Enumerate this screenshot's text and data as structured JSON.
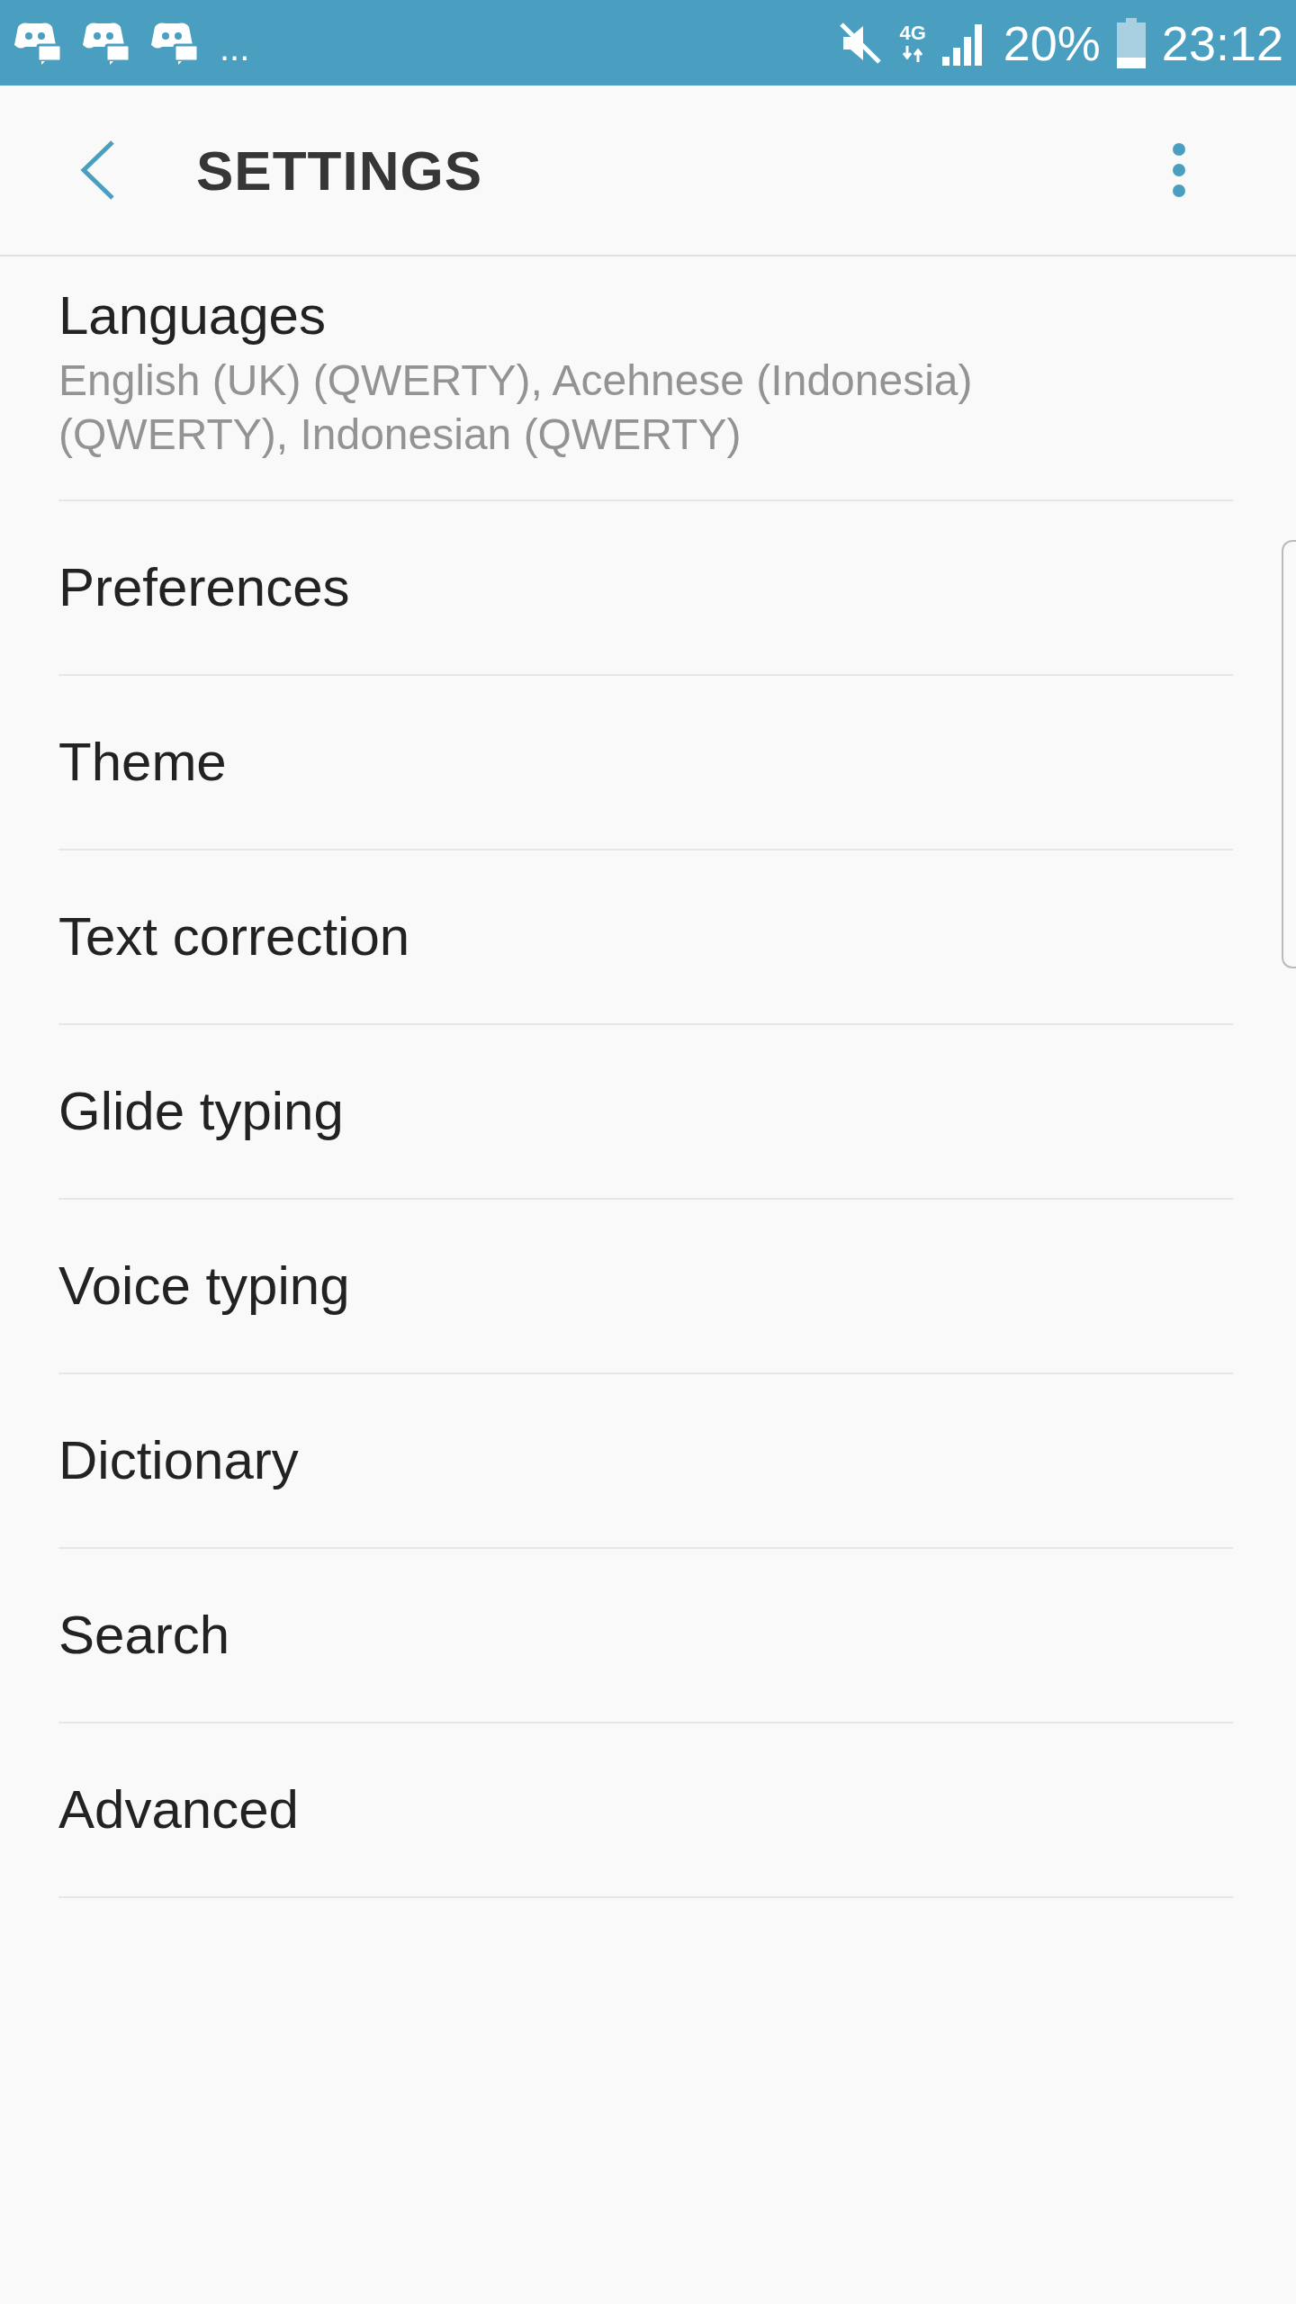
{
  "status_bar": {
    "notifications": [
      {
        "kind": "chat"
      },
      {
        "kind": "chat"
      },
      {
        "kind": "chat"
      }
    ],
    "more": "...",
    "network": "4G",
    "battery": "20%",
    "time": "23:12"
  },
  "header": {
    "title": "SETTINGS"
  },
  "items": [
    {
      "title": "Languages",
      "subtitle": "English (UK) (QWERTY), Acehnese (Indonesia) (QWERTY), Indonesian (QWERTY)"
    },
    {
      "title": "Preferences"
    },
    {
      "title": "Theme"
    },
    {
      "title": "Text correction"
    },
    {
      "title": "Glide typing"
    },
    {
      "title": "Voice typing"
    },
    {
      "title": "Dictionary"
    },
    {
      "title": "Search"
    },
    {
      "title": "Advanced"
    }
  ]
}
